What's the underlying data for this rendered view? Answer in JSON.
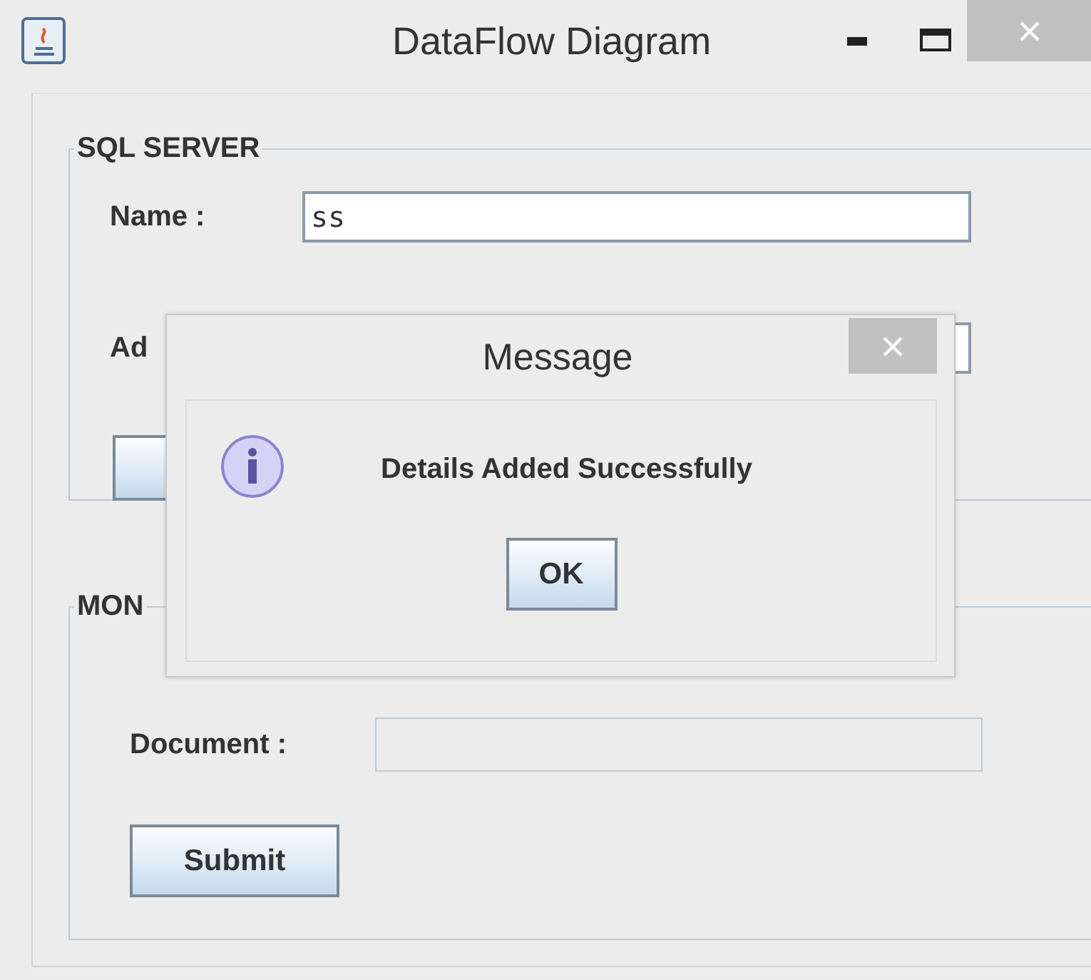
{
  "window": {
    "title": "DataFlow Diagram"
  },
  "sql_server": {
    "legend": "SQL SERVER",
    "name_label": "Name :",
    "name_value": "ss",
    "address_label": "Ad"
  },
  "mongo": {
    "legend": "MON",
    "document_label": "Document :",
    "document_disabled": true,
    "submit": "Submit"
  },
  "dialog": {
    "title": "Message",
    "message": "Details Added Successfully",
    "button": "OK"
  }
}
